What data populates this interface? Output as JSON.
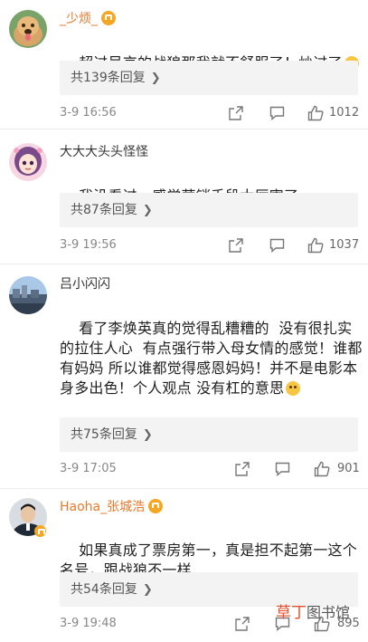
{
  "comments": [
    {
      "username": "_少烦_",
      "text": "超过吴京的战狼那我就不舒服了！炒过了",
      "replies_label": "共139条回复",
      "time": "3-9 16:56",
      "likes": "1012"
    },
    {
      "username": "大大大头头怪怪",
      "text": "我没看过，感觉营销手段太厉害了",
      "replies_label": "共87条回复",
      "time": "3-9 19:56",
      "likes": "1037"
    },
    {
      "username": "吕小闪闪",
      "text": "看了李焕英真的觉得乱糟糟的  没有很扎实的拉住人心  有点强行带入母女情的感觉！谁都有妈妈 所以谁都觉得感恩妈妈！并不是电影本身多出色！个人观点 没有杠的意思",
      "replies_label": "共75条回复",
      "time": "3-9 17:05",
      "likes": "901"
    },
    {
      "username": "Haoha_张城浩",
      "text": "如果真成了票房第一，真是担不起第一这个名号，跟战狼不一样",
      "replies_label": "共54条回复",
      "time": "3-9 19:48",
      "likes": "895"
    }
  ],
  "watermark": {
    "part1": "草丁",
    "part2": "图书馆"
  },
  "colors": {
    "username_orange": "#e87a2c",
    "reply_bg": "#f3f3f3",
    "meta_gray": "#888888"
  },
  "icons": [
    "share-icon",
    "comment-icon",
    "like-icon",
    "chevron-right-icon",
    "vip-badge-icon",
    "emoji-icon"
  ]
}
